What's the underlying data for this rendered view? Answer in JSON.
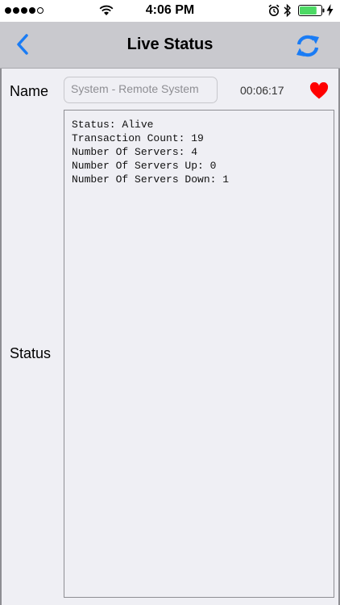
{
  "status_bar": {
    "time": "4:06 PM",
    "signal_bars_filled": 4,
    "signal_bars_total": 5,
    "battery_level_percent": 80,
    "icons": [
      "wifi-icon",
      "alarm-icon",
      "bluetooth-icon",
      "battery-icon",
      "charging-bolt-icon"
    ]
  },
  "nav": {
    "title": "Live Status",
    "back_icon": "chevron-left-icon",
    "refresh_icon": "refresh-icon"
  },
  "form": {
    "name_label": "Name",
    "name_value": "System - Remote System",
    "timer": "00:06:17",
    "heart_icon": "heart-icon",
    "status_label": "Status",
    "status_lines": [
      "Status: Alive",
      "Transaction Count: 19",
      "Number Of Servers: 4",
      "Number Of Servers Up: 0",
      "Number Of Servers Down: 1"
    ]
  },
  "colors": {
    "accent": "#1a7cf5",
    "heart": "#ff0000",
    "nav_background": "#c9c9ce",
    "content_background": "#efeff4",
    "battery_fill": "#4cd964"
  }
}
